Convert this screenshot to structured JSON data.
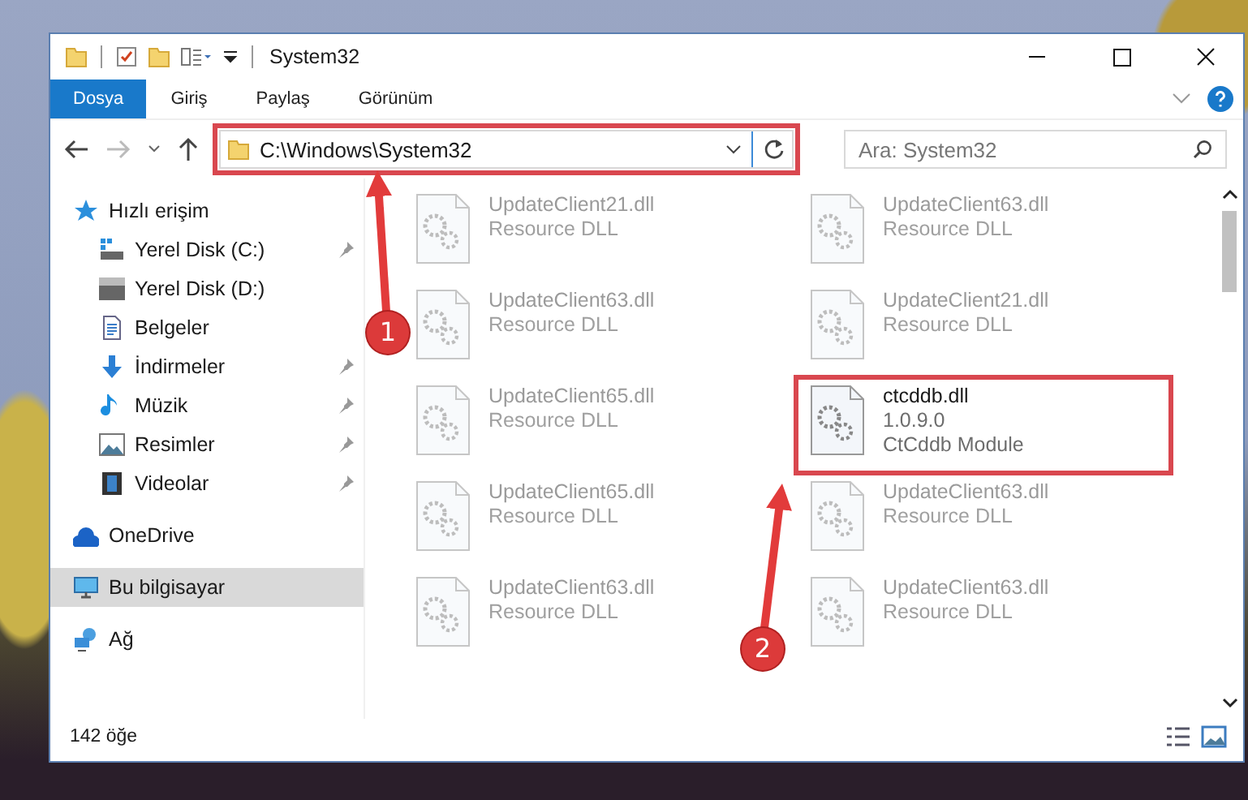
{
  "window": {
    "title": "System32"
  },
  "ribbon_tabs": [
    {
      "label": "Dosya",
      "selected": true
    },
    {
      "label": "Giriş",
      "selected": false
    },
    {
      "label": "Paylaş",
      "selected": false
    },
    {
      "label": "Görünüm",
      "selected": false
    }
  ],
  "address": {
    "value": "C:\\Windows\\System32",
    "highlighted": true
  },
  "search": {
    "placeholder": "Ara: System32"
  },
  "sidebar": {
    "items": [
      {
        "label": "Hızlı erişim",
        "kind": "star",
        "selected": false,
        "pinned": false,
        "children": [
          {
            "label": "Yerel Disk (C:)",
            "kind": "drive-c",
            "selected": false,
            "pinned": true
          },
          {
            "label": "Yerel Disk (D:)",
            "kind": "drive",
            "selected": false,
            "pinned": false
          },
          {
            "label": "Belgeler",
            "kind": "document",
            "selected": false,
            "pinned": false
          },
          {
            "label": "İndirmeler",
            "kind": "download",
            "selected": false,
            "pinned": true
          },
          {
            "label": "Müzik",
            "kind": "music",
            "selected": false,
            "pinned": true
          },
          {
            "label": "Resimler",
            "kind": "pictures",
            "selected": false,
            "pinned": true
          },
          {
            "label": "Videolar",
            "kind": "video",
            "selected": false,
            "pinned": true
          }
        ]
      },
      {
        "label": "OneDrive",
        "kind": "cloud",
        "selected": false,
        "pinned": false
      },
      {
        "label": "Bu bilgisayar",
        "kind": "computer",
        "selected": true,
        "pinned": false
      },
      {
        "label": "Ağ",
        "kind": "network",
        "selected": false,
        "pinned": false
      }
    ]
  },
  "files": [
    {
      "name": "UpdateClient21.dll",
      "details": [
        "Resource DLL"
      ],
      "faded": true,
      "highlighted": false
    },
    {
      "name": "UpdateClient63.dll",
      "details": [
        "Resource DLL"
      ],
      "faded": true,
      "highlighted": false
    },
    {
      "name": "UpdateClient63.dll",
      "details": [
        "Resource DLL"
      ],
      "faded": true,
      "highlighted": false
    },
    {
      "name": "UpdateClient21.dll",
      "details": [
        "Resource DLL"
      ],
      "faded": true,
      "highlighted": false
    },
    {
      "name": "UpdateClient65.dll",
      "details": [
        "Resource DLL"
      ],
      "faded": true,
      "highlighted": false
    },
    {
      "name": "ctcddb.dll",
      "details": [
        "1.0.9.0",
        "CtCddb Module"
      ],
      "faded": false,
      "highlighted": true
    },
    {
      "name": "UpdateClient65.dll",
      "details": [
        "Resource DLL"
      ],
      "faded": true,
      "highlighted": false
    },
    {
      "name": "UpdateClient63.dll",
      "details": [
        "Resource DLL"
      ],
      "faded": true,
      "highlighted": false
    },
    {
      "name": "UpdateClient63.dll",
      "details": [
        "Resource DLL"
      ],
      "faded": true,
      "highlighted": false
    },
    {
      "name": "UpdateClient63.dll",
      "details": [
        "Resource DLL"
      ],
      "faded": true,
      "highlighted": false
    }
  ],
  "status_bar": {
    "count": "142 öğe"
  },
  "annotations": [
    {
      "number": "1"
    },
    {
      "number": "2"
    }
  ]
}
